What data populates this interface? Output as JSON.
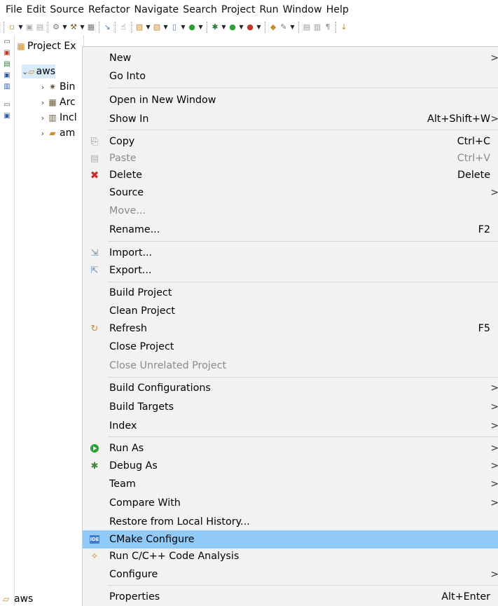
{
  "menubar": {
    "items": [
      "File",
      "Edit",
      "Source",
      "Refactor",
      "Navigate",
      "Search",
      "Project",
      "Run",
      "Window",
      "Help"
    ]
  },
  "explorer": {
    "title": "Project Ex",
    "tree": [
      {
        "label": "aws",
        "icon": "project-folder-icon",
        "expanded": true
      },
      {
        "label": "Bin",
        "icon": "binaries-icon"
      },
      {
        "label": "Arc",
        "icon": "archives-icon"
      },
      {
        "label": "Incl",
        "icon": "includes-icon"
      },
      {
        "label": "am",
        "icon": "folder-icon"
      }
    ],
    "status_label": "aws"
  },
  "context_menu": {
    "items": [
      {
        "label": "New",
        "submenu": true
      },
      {
        "label": "Go Into"
      },
      {
        "label": "Open in New Window"
      },
      {
        "label": "Show In",
        "shortcut": "Alt+Shift+W",
        "submenu": true
      },
      {
        "label": "Copy",
        "shortcut": "Ctrl+C",
        "icon": "copy-icon"
      },
      {
        "label": "Paste",
        "shortcut": "Ctrl+V",
        "icon": "paste-icon",
        "disabled": true
      },
      {
        "label": "Delete",
        "shortcut": "Delete",
        "icon": "delete-icon"
      },
      {
        "label": "Source",
        "submenu": true
      },
      {
        "label": "Move...",
        "disabled": true
      },
      {
        "label": "Rename...",
        "shortcut": "F2"
      },
      {
        "label": "Import...",
        "icon": "import-icon"
      },
      {
        "label": "Export...",
        "icon": "export-icon"
      },
      {
        "label": "Build Project"
      },
      {
        "label": "Clean Project"
      },
      {
        "label": "Refresh",
        "shortcut": "F5",
        "icon": "refresh-icon"
      },
      {
        "label": "Close Project"
      },
      {
        "label": "Close Unrelated Project",
        "disabled": true
      },
      {
        "label": "Build Configurations",
        "submenu": true
      },
      {
        "label": "Build Targets",
        "submenu": true
      },
      {
        "label": "Index",
        "submenu": true
      },
      {
        "label": "Run As",
        "submenu": true,
        "icon": "run-icon"
      },
      {
        "label": "Debug As",
        "submenu": true,
        "icon": "debug-icon"
      },
      {
        "label": "Team",
        "submenu": true
      },
      {
        "label": "Compare With",
        "submenu": true
      },
      {
        "label": "Restore from Local History..."
      },
      {
        "label": "CMake Configure",
        "icon": "cmake-ide-icon",
        "highlighted": true,
        "badge": "IDE"
      },
      {
        "label": "Run C/C++ Code Analysis",
        "icon": "code-analysis-icon"
      },
      {
        "label": "Configure",
        "submenu": true
      },
      {
        "label": "Properties",
        "shortcut": "Alt+Enter"
      }
    ],
    "submenu_arrow": ">"
  },
  "colors": {
    "menu_bg": "#f2f2f2",
    "highlight": "#91c9f7",
    "disabled_text": "#8a8a8a",
    "delete_red": "#d0282d",
    "run_green": "#2e9e3a"
  }
}
